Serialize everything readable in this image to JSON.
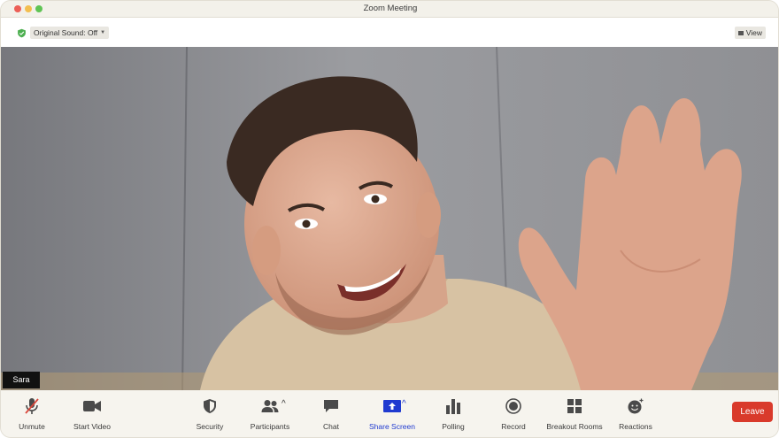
{
  "window": {
    "title": "Zoom Meeting"
  },
  "topbar": {
    "original_sound": "Original Sound: Off",
    "view": "View",
    "accent": "#4caf50"
  },
  "video": {
    "participant_name": "Sara"
  },
  "controls": {
    "unmute": "Unmute",
    "start_video": "Start Video",
    "security": "Security",
    "participants": "Participants",
    "chat": "Chat",
    "share_screen": "Share Screen",
    "polling": "Polling",
    "record": "Record",
    "breakout_rooms": "Breakout Rooms",
    "reactions": "Reactions",
    "leave": "Leave"
  },
  "colors": {
    "leave": "#d93a2b",
    "share": "#1f3ad0",
    "mute_slash": "#d9473b"
  },
  "icons": [
    "shield-check-icon",
    "chevron-down-icon",
    "view-icon",
    "microphone-muted-icon",
    "video-camera-icon",
    "security-shield-icon",
    "participants-icon",
    "chevron-up-icon",
    "chat-bubble-icon",
    "share-screen-icon",
    "polling-bars-icon",
    "record-icon",
    "breakout-rooms-icon",
    "reactions-smile-icon"
  ]
}
